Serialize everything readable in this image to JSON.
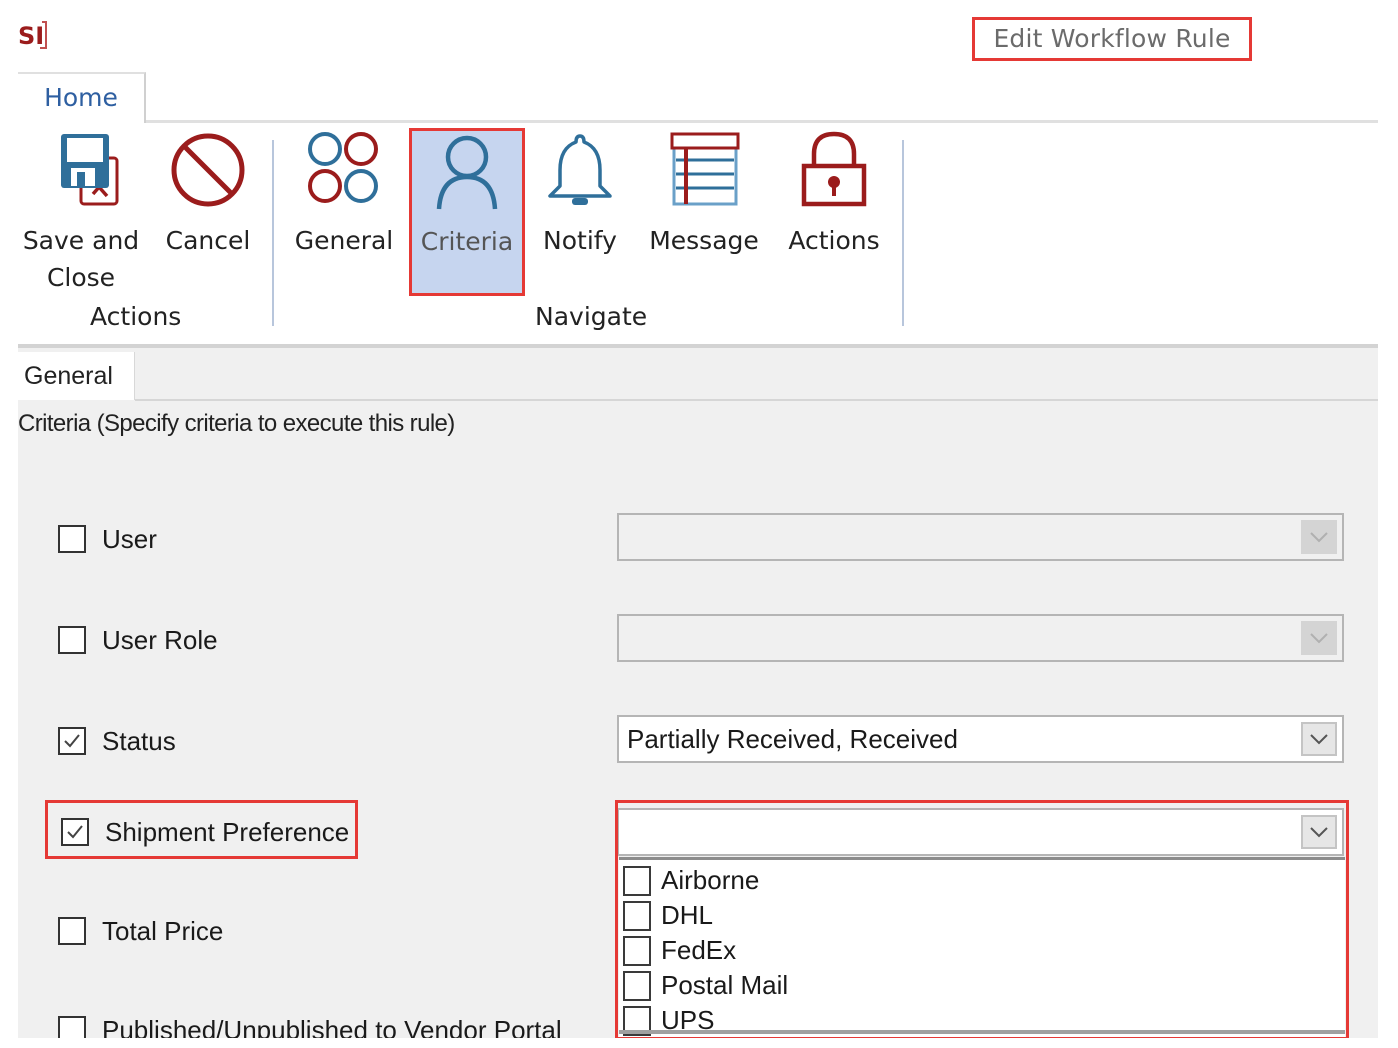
{
  "app": {
    "logo_text": "SI",
    "window_title": "Edit Workflow Rule"
  },
  "ribbon": {
    "tabs": [
      {
        "label": "Home",
        "active": true
      }
    ],
    "groups": [
      {
        "label": "Actions",
        "buttons": [
          {
            "label_line1": "Save and",
            "label_line2": "Close",
            "icon": "save-close-icon"
          },
          {
            "label_line1": "Cancel",
            "icon": "cancel-icon"
          }
        ]
      },
      {
        "label": "Navigate",
        "buttons": [
          {
            "label_line1": "General",
            "icon": "general-circles-icon"
          },
          {
            "label_line1": "Criteria",
            "icon": "user-icon",
            "selected": true
          },
          {
            "label_line1": "Notify",
            "icon": "bell-icon"
          },
          {
            "label_line1": "Message",
            "icon": "message-list-icon"
          },
          {
            "label_line1": "Actions",
            "icon": "lock-icon"
          }
        ]
      }
    ]
  },
  "content": {
    "tab_label": "General",
    "section_title": "Criteria (Specify criteria to execute this rule)",
    "criteria": [
      {
        "label": "User",
        "checked": false,
        "value": "",
        "enabled": false
      },
      {
        "label": "User Role",
        "checked": false,
        "value": "",
        "enabled": false
      },
      {
        "label": "Status",
        "checked": true,
        "value": "Partially Received, Received",
        "enabled": true
      },
      {
        "label": "Shipment Preference",
        "checked": true,
        "value": "",
        "enabled": true,
        "dropdown_open": true
      },
      {
        "label": "Total Price",
        "checked": false
      },
      {
        "label": "Published/Unpublished to Vendor Portal",
        "checked": false
      }
    ],
    "shipment_options": [
      {
        "label": "Airborne",
        "checked": false
      },
      {
        "label": "DHL",
        "checked": false
      },
      {
        "label": "FedEx",
        "checked": false
      },
      {
        "label": "Postal Mail",
        "checked": false
      },
      {
        "label": "UPS",
        "checked": false
      }
    ]
  },
  "colors": {
    "highlight": "#e53935",
    "selected_bg": "#c6d5ef",
    "icon_blue": "#2f6f9a",
    "icon_red": "#9b1c1c",
    "tab_text": "#2e5fa1"
  }
}
